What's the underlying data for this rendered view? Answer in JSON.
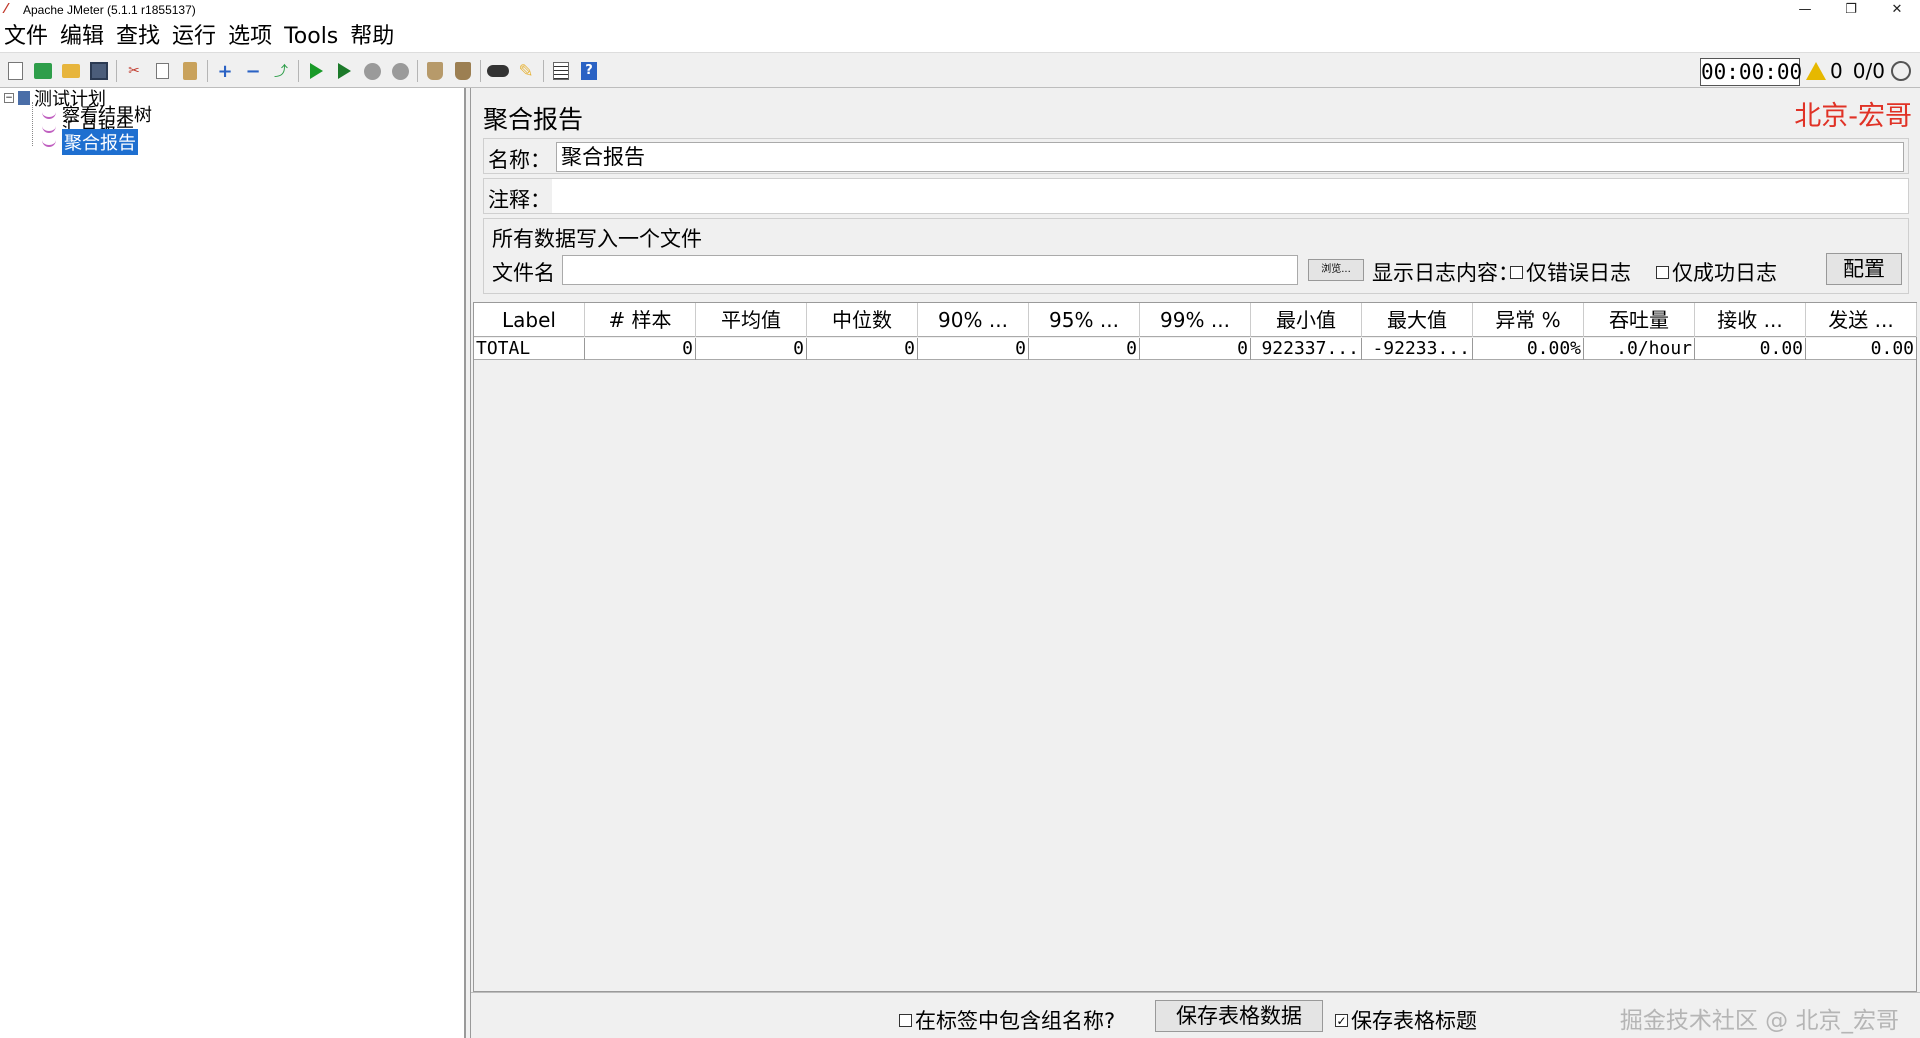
{
  "window": {
    "title": "Apache JMeter (5.1.1 r1855137)",
    "controls": [
      "—",
      "❐",
      "✕"
    ]
  },
  "menu": [
    "文件",
    "编辑",
    "查找",
    "运行",
    "选项",
    "Tools",
    "帮助"
  ],
  "toolbar": {
    "icons": [
      "new-icon",
      "templates-icon",
      "open-icon",
      "save-icon",
      "cut-icon",
      "copy-icon",
      "paste-icon",
      "expand-icon",
      "collapse-icon",
      "toggle-icon",
      "start-icon",
      "start-no-pause-icon",
      "stop-icon",
      "shutdown-icon",
      "clear-icon",
      "clear-all-icon",
      "search-icon",
      "reset-search-icon",
      "function-helper-icon",
      "help-icon"
    ],
    "timer": "00:00:00",
    "warning_count": "0",
    "threads": "0/0"
  },
  "tree": {
    "root": "测试计划",
    "children": [
      "察看结果树",
      "汇总报告",
      "聚合报告"
    ]
  },
  "panel": {
    "title": "聚合报告",
    "brand_watermark": "北京-宏哥",
    "name_label": "名称：",
    "name_value": "聚合报告",
    "comment_label": "注释：",
    "comment_value": "",
    "file_group_title": "所有数据写入一个文件",
    "file_label": "文件名",
    "file_value": "",
    "browse_label": "浏览...",
    "log_label": "显示日志内容：",
    "errors_only_label": "仅错误日志",
    "success_only_label": "仅成功日志",
    "config_label": "配置"
  },
  "table": {
    "headers": [
      "Label",
      "# 样本",
      "平均值",
      "中位数",
      "90% ...",
      "95% ...",
      "99% ...",
      "最小值",
      "最大值",
      "异常 %",
      "吞吐量",
      "接收 ...",
      "发送 ..."
    ],
    "rows": [
      [
        "TOTAL",
        "0",
        "0",
        "0",
        "0",
        "0",
        "0",
        "922337...",
        "-92233...",
        "0.00%",
        ".0/hour",
        "0.00",
        "0.00"
      ]
    ]
  },
  "bottom": {
    "include_group_label": "在标签中包含组名称?",
    "save_table_label": "保存表格数据",
    "save_header_label": "保存表格标题",
    "watermark": "掘金技术社区 @ 北京_宏哥"
  }
}
